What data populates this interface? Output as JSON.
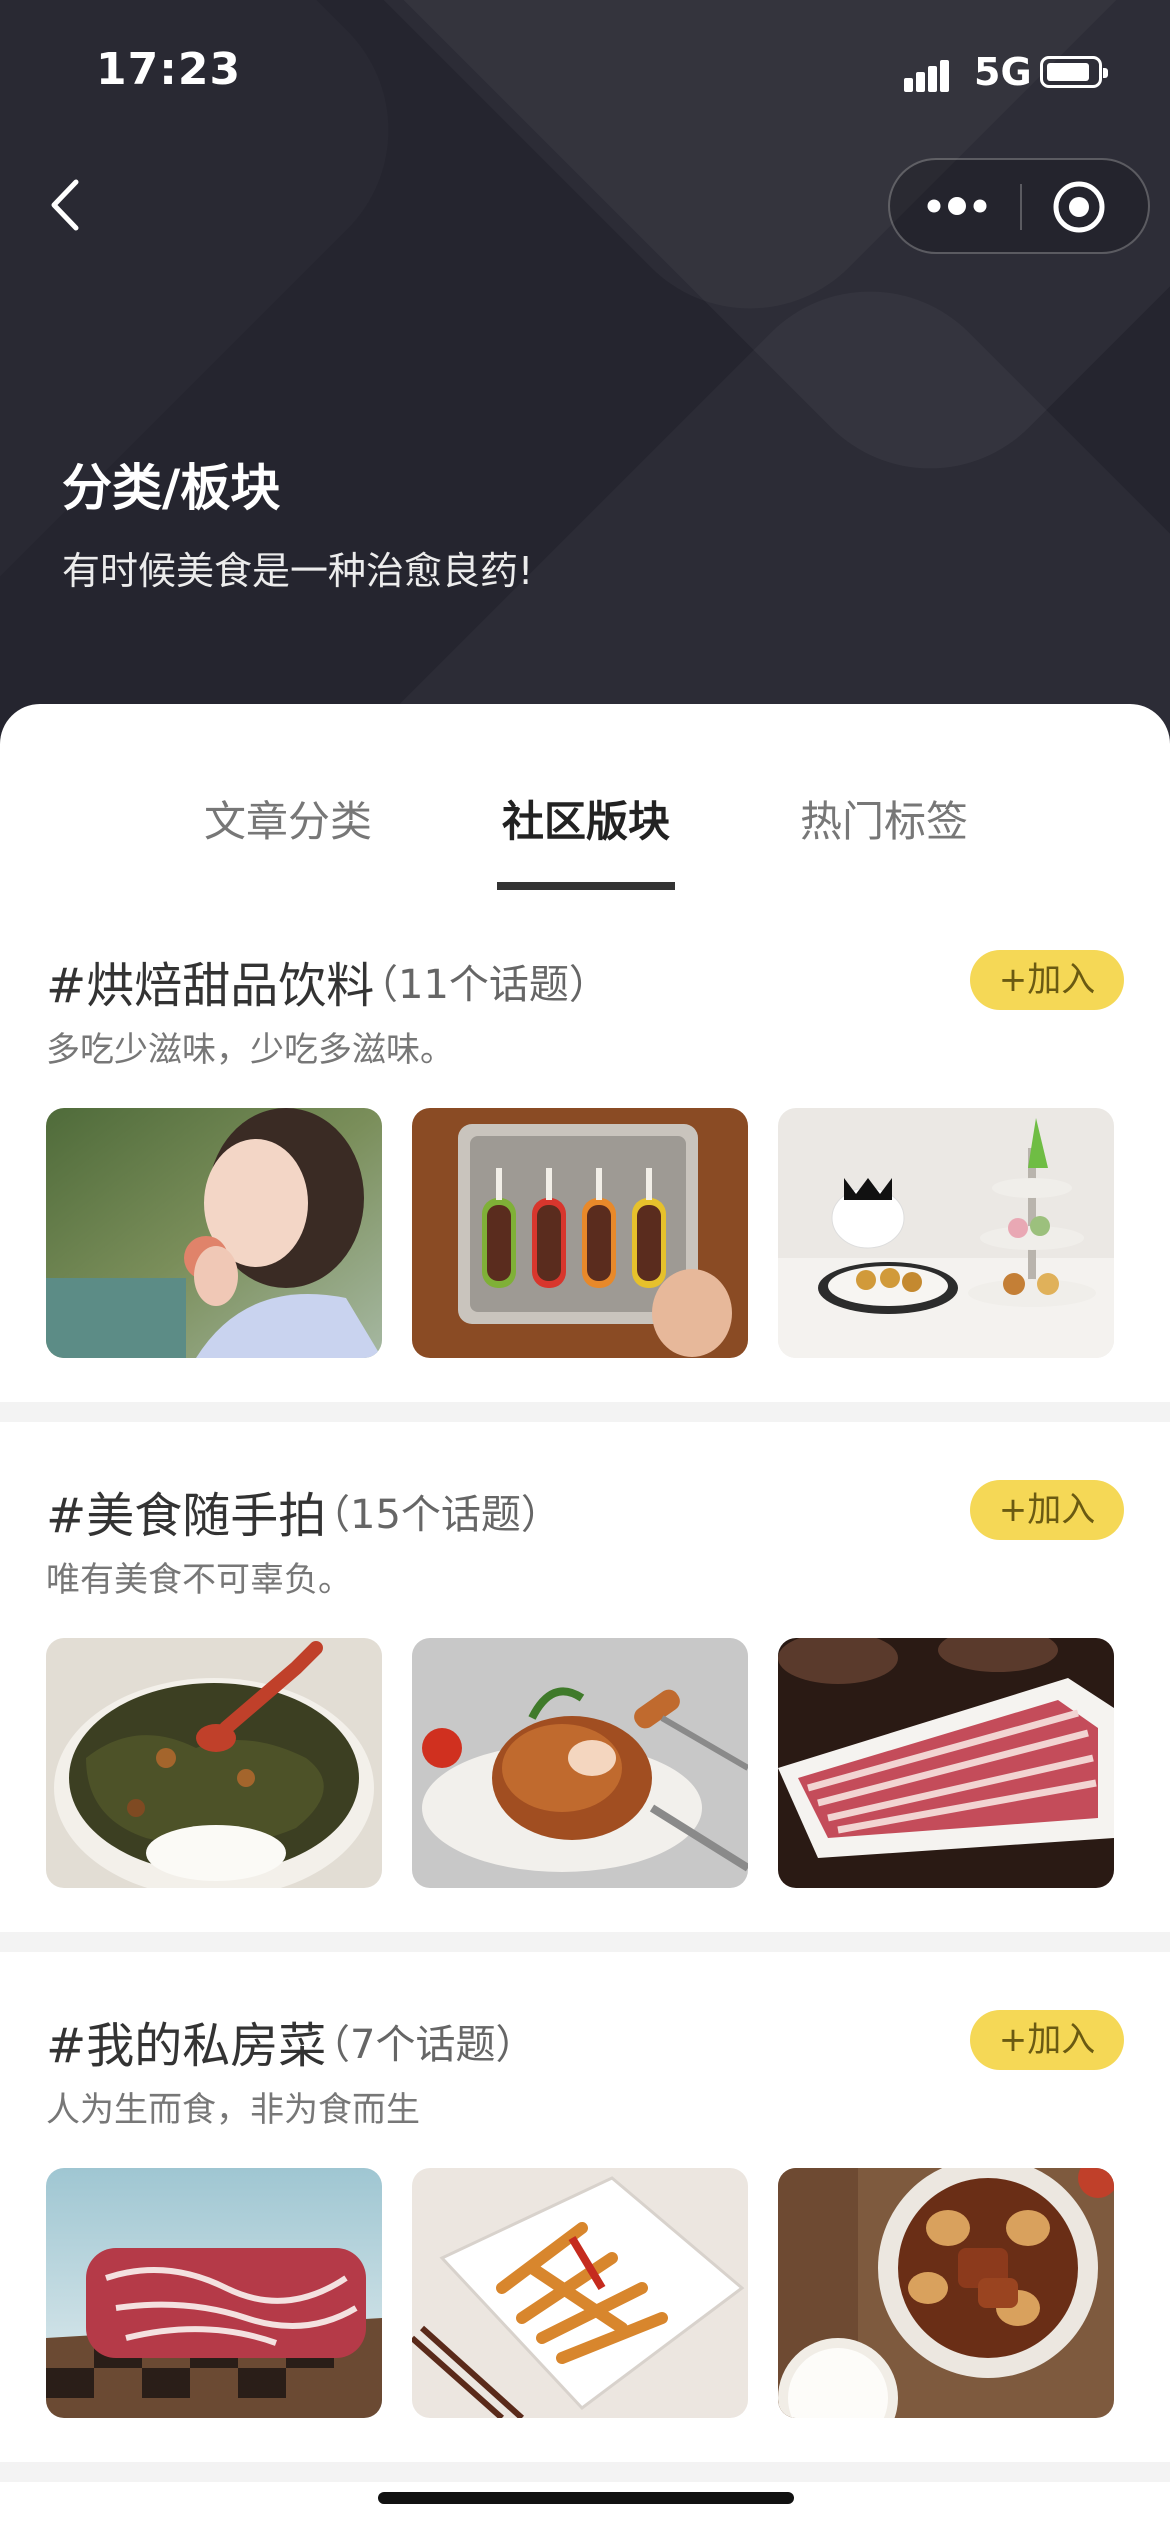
{
  "status_bar": {
    "time": "17:23",
    "network": "5G"
  },
  "header": {
    "title": "分类/板块",
    "subtitle": "有时候美食是一种治愈良药!"
  },
  "tabs": [
    {
      "label": "文章分类",
      "active": false
    },
    {
      "label": "社区版块",
      "active": true
    },
    {
      "label": "热门标签",
      "active": false
    }
  ],
  "sections": [
    {
      "title": "#烘焙甜品饮料",
      "count": "（11个话题）",
      "desc": "多吃少滋味，少吃多滋味。",
      "join_label": "+加入",
      "images": [
        "woman-with-peach-photo",
        "popsicle-tray-photo",
        "afternoon-tea-photo"
      ]
    },
    {
      "title": "#美食随手拍",
      "count": "（15个话题）",
      "desc": "唯有美食不可辜负。",
      "join_label": "+加入",
      "images": [
        "rice-bowl-with-sauce-photo",
        "roast-chicken-leg-photo",
        "sliced-meat-platter-photo"
      ]
    },
    {
      "title": "#我的私房菜",
      "count": "（7个话题）",
      "desc": "人为生而食，非为食而生",
      "join_label": "+加入",
      "images": [
        "marbled-beef-photo",
        "braised-chicken-feet-photo",
        "braised-pork-eggs-photo"
      ]
    }
  ],
  "colors": {
    "header_bg": "#25252f",
    "join_button": "#f5d856",
    "active_tab_underline": "#333333"
  },
  "icons": {
    "back": "chevron-left-icon",
    "more": "more-dots-icon",
    "close": "target-close-icon"
  }
}
